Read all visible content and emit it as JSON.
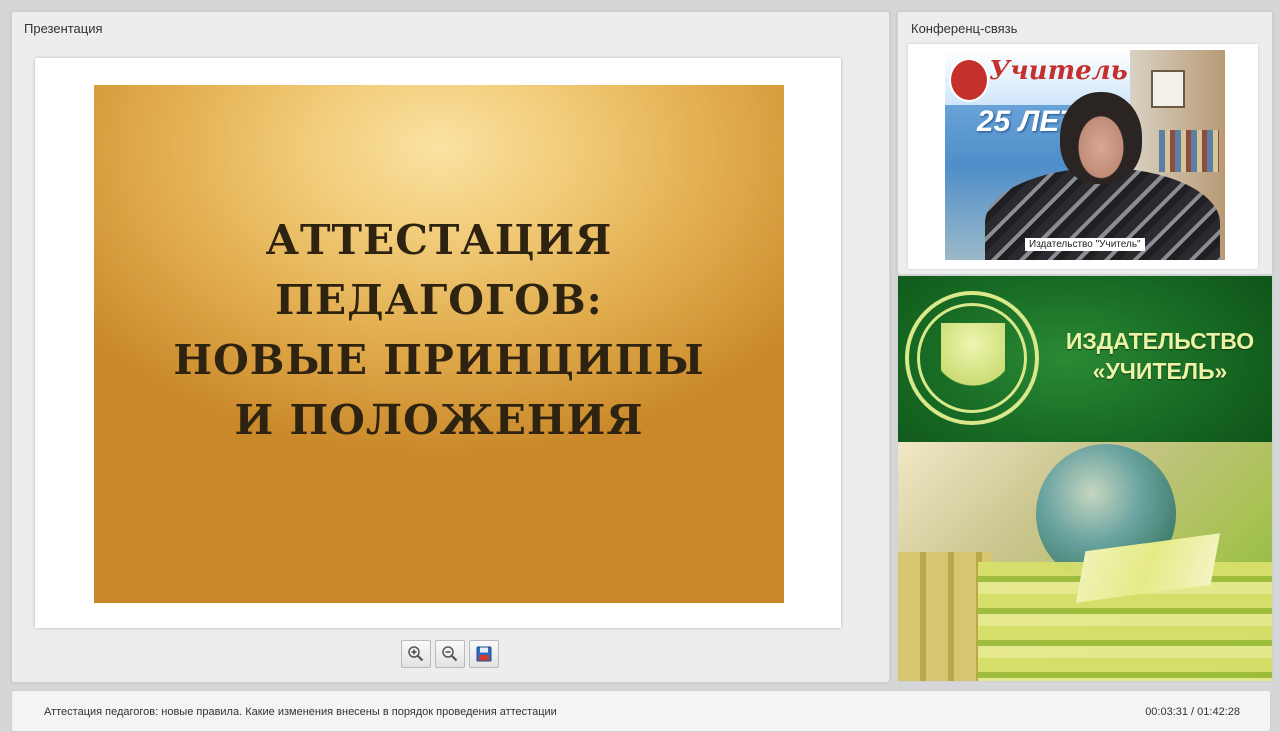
{
  "presentation": {
    "title": "Презентация",
    "slide": {
      "lines": [
        "АТТЕСТАЦИЯ",
        "ПЕДАГОГОВ:",
        "НОВЫЕ ПРИНЦИПЫ",
        "И ПОЛОЖЕНИЯ"
      ]
    },
    "toolbar": {
      "zoom_in_icon": "zoom-in-icon",
      "zoom_out_icon": "zoom-out-icon",
      "save_icon": "save-icon"
    }
  },
  "conference": {
    "title": "Конференц-связь",
    "video": {
      "banner_brand": "Учитель",
      "banner_years": "25 ЛЕТ",
      "caption": "Издательство \"Учитель\""
    }
  },
  "promo": {
    "line1": "ИЗДАТЕЛЬСТВО",
    "line2": "«УЧИТЕЛЬ»"
  },
  "status": {
    "title": "Аттестация педагогов: новые правила. Какие изменения внесены в порядок проведения аттестации",
    "time": "00:03:31 / 01:42:28"
  },
  "colors": {
    "promo_green": "#176a23",
    "promo_text": "#ecf3a6",
    "slide_gold": "#e0aa4a",
    "slide_text": "#2e2310"
  }
}
